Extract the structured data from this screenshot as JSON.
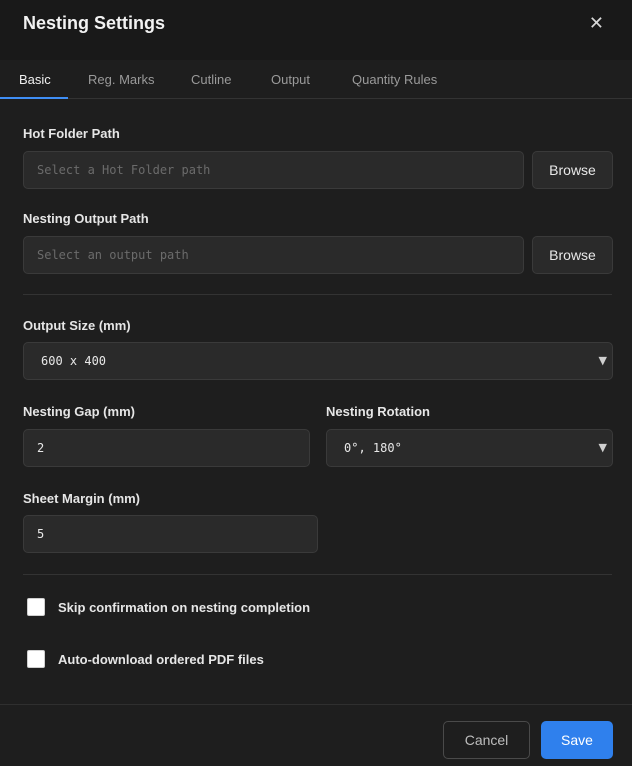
{
  "dialog": {
    "title": "Nesting Settings",
    "close_glyph": "✕"
  },
  "tabs": [
    {
      "label": "Basic",
      "active": true
    },
    {
      "label": "Reg. Marks",
      "active": false
    },
    {
      "label": "Cutline",
      "active": false
    },
    {
      "label": "Output",
      "active": false
    },
    {
      "label": "Quantity Rules",
      "active": false
    }
  ],
  "hot_folder": {
    "label": "Hot Folder Path",
    "value": "",
    "placeholder": "Select a Hot Folder path",
    "browse_label": "Browse"
  },
  "output_path": {
    "label": "Nesting Output Path",
    "value": "",
    "placeholder": "Select an output path",
    "browse_label": "Browse"
  },
  "output_size": {
    "label": "Output Size (mm)",
    "selected": "600 x 400"
  },
  "nesting_gap": {
    "label": "Nesting Gap (mm)",
    "value": "2"
  },
  "nesting_rotation": {
    "label": "Nesting Rotation",
    "selected": "0°, 180°"
  },
  "sheet_margin": {
    "label": "Sheet Margin (mm)",
    "value": "5"
  },
  "options": {
    "skip_confirmation": {
      "label": "Skip confirmation on nesting completion",
      "checked": false
    },
    "auto_download": {
      "label": "Auto-download ordered PDF files",
      "checked": false
    }
  },
  "footer": {
    "cancel_label": "Cancel",
    "save_label": "Save"
  },
  "colors": {
    "background": "#1e1e1e",
    "header": "#191919",
    "accent": "#2f80ed",
    "input_bg": "#2a2a2a"
  },
  "icons": {
    "close": "close-icon",
    "dropdown": "chevron-down-icon"
  }
}
